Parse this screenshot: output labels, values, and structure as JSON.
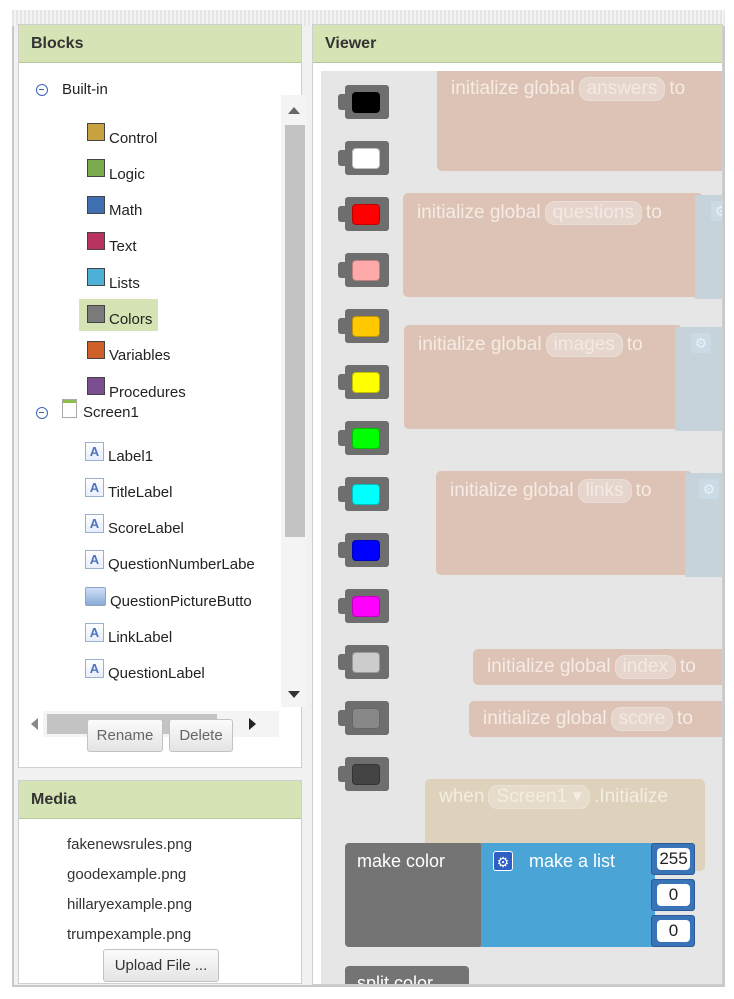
{
  "blocks_panel": {
    "title": "Blocks",
    "builtin": {
      "label": "Built-in",
      "items": [
        {
          "label": "Control",
          "color": "#c9a13f"
        },
        {
          "label": "Logic",
          "color": "#7bab4c"
        },
        {
          "label": "Math",
          "color": "#3f6fb0"
        },
        {
          "label": "Text",
          "color": "#b8345e"
        },
        {
          "label": "Lists",
          "color": "#4fb0d8"
        },
        {
          "label": "Colors",
          "color": "#7a7a7a"
        },
        {
          "label": "Variables",
          "color": "#d0602a"
        },
        {
          "label": "Procedures",
          "color": "#7b4f8f"
        }
      ]
    },
    "screen": {
      "label": "Screen1",
      "items": [
        {
          "label": "Label1",
          "icon": "label"
        },
        {
          "label": "TitleLabel",
          "icon": "label"
        },
        {
          "label": "ScoreLabel",
          "icon": "label"
        },
        {
          "label": "QuestionNumberLabe",
          "icon": "label"
        },
        {
          "label": "QuestionPictureButto",
          "icon": "button"
        },
        {
          "label": "LinkLabel",
          "icon": "label"
        },
        {
          "label": "QuestionLabel",
          "icon": "label"
        }
      ]
    },
    "selected": "Colors",
    "rename_label": "Rename",
    "delete_label": "Delete"
  },
  "media_panel": {
    "title": "Media",
    "files": [
      "fakenewsrules.png",
      "goodexample.png",
      "hillaryexample.png",
      "trumpexample.png"
    ],
    "upload_label": "Upload File ..."
  },
  "viewer": {
    "title": "Viewer",
    "color_blocks": [
      "#000000",
      "#ffffff",
      "#ff0000",
      "#ffaaaa",
      "#ffc800",
      "#ffff00",
      "#00ff00",
      "#00ffff",
      "#0000ff",
      "#ff00ff",
      "#cccccc",
      "#888888",
      "#444444"
    ],
    "ghost_blocks": {
      "kw_initialize": "initialize global",
      "kw_to": "to",
      "var_answers": "answers",
      "var_questions": "questions",
      "var_images": "images",
      "var_links": "links",
      "var_index": "index",
      "var_score": "score",
      "kw_when": "when",
      "component": "Screen1",
      "event": ".Initialize"
    },
    "make_color": {
      "label": "make color",
      "list_label": "make a list",
      "values": [
        "255",
        "0",
        "0"
      ]
    },
    "split_color": "split color"
  }
}
